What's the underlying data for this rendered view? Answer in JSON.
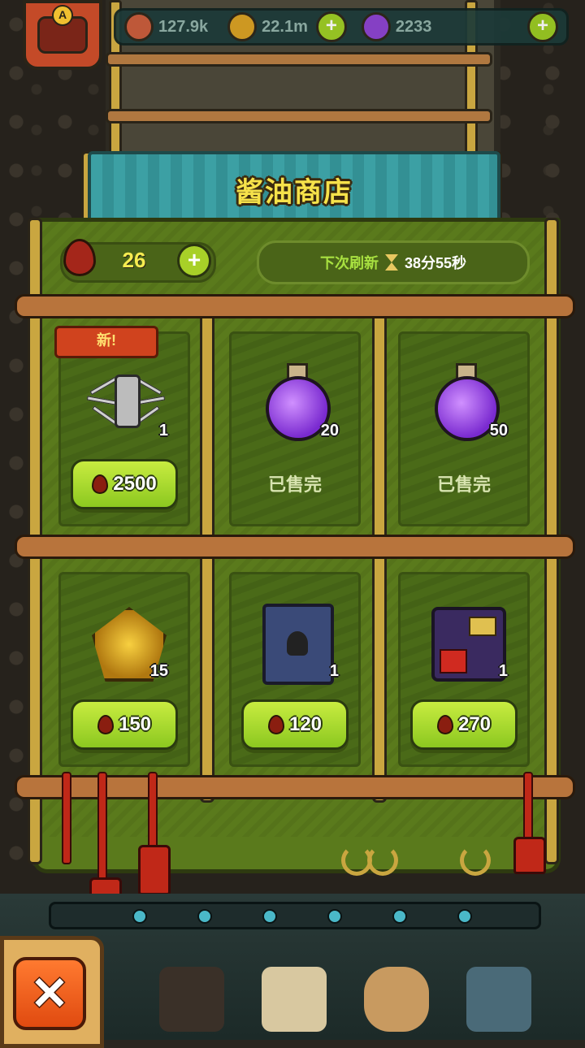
{
  "hud": {
    "stat_1": "127.9k",
    "stat_2": "22.1m",
    "stat_3": "2233",
    "avatar_badge": "A"
  },
  "shop": {
    "title": "酱油商店",
    "currency_icon": "soy-sauce-drop-icon",
    "balance": "26",
    "refresh_label": "下次刷新",
    "refresh_time": "38分55秒",
    "items": [
      {
        "icon": "spider-creature",
        "qty": "1",
        "price": "2500",
        "badge": "新!",
        "sold_out": false
      },
      {
        "icon": "purple-potion",
        "qty": "20",
        "status": "已售完",
        "sold_out": true
      },
      {
        "icon": "purple-potion",
        "qty": "50",
        "status": "已售完",
        "sold_out": true
      },
      {
        "icon": "gold-gem",
        "qty": "15",
        "price": "150",
        "sold_out": false
      },
      {
        "icon": "robot-card",
        "qty": "1",
        "price": "120",
        "sold_out": false
      },
      {
        "icon": "treasure-pile",
        "qty": "1",
        "price": "270",
        "sold_out": false
      }
    ]
  },
  "close_label": "✕",
  "colors": {
    "banner": "#3ca0a4",
    "panel": "#5a7a1c",
    "price_button": "#a8dc30",
    "title_text": "#f6e24a",
    "close_button": "#f06020"
  }
}
